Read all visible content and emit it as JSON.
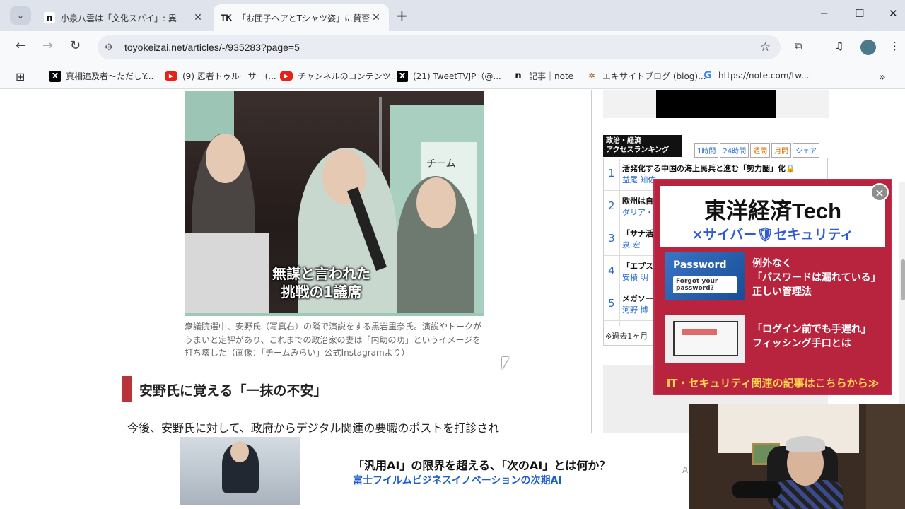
{
  "browser": {
    "tabs": [
      {
        "label": "小泉八雲は「文化スパイ」: 異"
      },
      {
        "label": "「お団子ヘアとTシャツ姿」に賛否も"
      }
    ],
    "tab_favicons": [
      "n",
      "TK"
    ],
    "url": "toyokeizai.net/articles/-/935283?page=5",
    "new_tab": "+",
    "window": {
      "minimize": "─",
      "maximize": "☐",
      "close": "✕"
    }
  },
  "bookmarks": [
    {
      "label": "真相追及者～ただしY...",
      "icon": "x-icon"
    },
    {
      "label": "(9) 忍者トゥルーサー(...",
      "icon": "youtube-icon"
    },
    {
      "label": "チャンネルのコンテンツ...",
      "icon": "youtube-icon"
    },
    {
      "label": "(21) TweetTVJP（@...",
      "icon": "x-icon"
    },
    {
      "label": "記事｜note",
      "icon": "note-icon"
    },
    {
      "label": "エキサイトブログ (blog)...",
      "icon": "excite-icon"
    },
    {
      "label": "https://note.com/tw...",
      "icon": "google-icon"
    }
  ],
  "article": {
    "photo_overlay_line1": "無謀と言われた",
    "photo_overlay_line2": "挑戦の1議席",
    "photo_sign": "チーム",
    "caption": "衆議院選中、安野氏（写真右）の隣で演説をする黒岩里奈氏。演説やトークがうまいと定評があり、これまでの政治家の妻は「内助の功」というイメージを打ち壊した（画像：「チームみらい」公式Instagramより）",
    "heading": "安野氏に覚える「一抹の不安」",
    "body": "今後、安野氏に対して、政府からデジタル関連の要職のポストを打診され"
  },
  "ranking": {
    "title_line1": "政治・経済",
    "title_line2": "アクセスランキング",
    "tabs": [
      "1時間",
      "24時間",
      "週間",
      "月間",
      "シェア"
    ],
    "items": [
      {
        "rank": "1",
        "title": "活発化する中国の海上民兵と進む「勢力圏」化🔒",
        "author": "益尾 知佐"
      },
      {
        "rank": "2",
        "title": "欧州は自",
        "author": "ダリア・"
      },
      {
        "rank": "3",
        "title": "「サナ活",
        "author": "泉 宏"
      },
      {
        "rank": "4",
        "title": "「エプス",
        "author": "安積 明"
      },
      {
        "rank": "5",
        "title": "メガソー",
        "author": "河野 博"
      }
    ],
    "note": "※過去1ヶ月"
  },
  "popup_ad": {
    "title": "東洋経済Tech",
    "subtitle": "×サイバー🛡セキュリティ",
    "item1_thumb": "Password",
    "item1_thumb_sub": "Forgot your password?",
    "item1_line1": "例外なく",
    "item1_line2": "「パスワードは漏れている」",
    "item1_line3": "正しい管理法",
    "item2_line1": "「ログイン前でも手遅れ」",
    "item2_line2": "フィッシング手口とは",
    "footer": "IT・セキュリティ関連の記事はこちらから≫",
    "close": "✕"
  },
  "bottom_ad": {
    "line1": "「汎用AI」の限界を超える、「次のAI」とは何か？",
    "line2": "富士フイルムビジネスイノベーションの次期AI",
    "badge": "A"
  }
}
